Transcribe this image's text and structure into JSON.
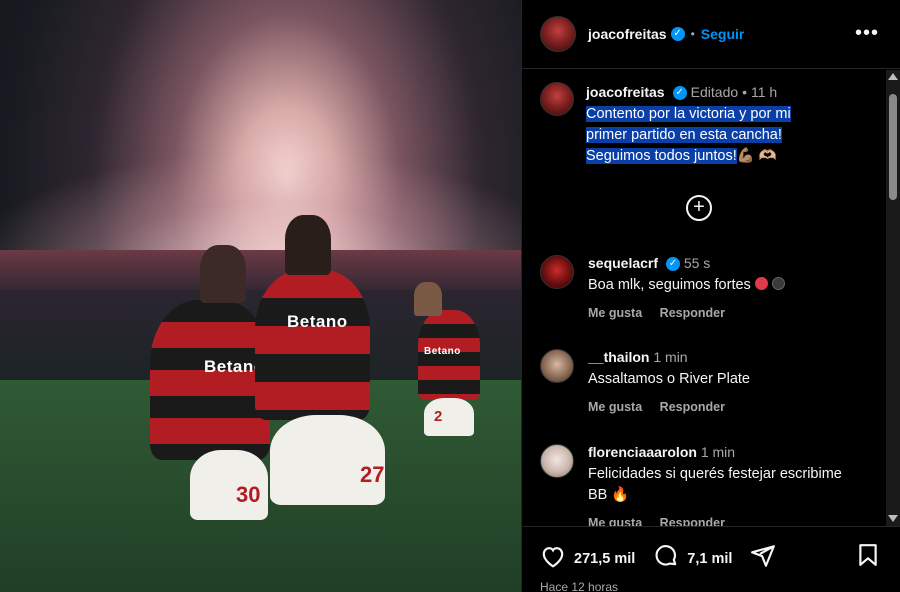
{
  "photo": {
    "sponsor_1": "Betano",
    "sponsor_2": "Betano",
    "sponsor_3": "Betano",
    "number_1": "30",
    "number_2": "27",
    "number_3": "2"
  },
  "header": {
    "username": "joacofreitas",
    "follow_label": "Seguir",
    "more_label": "•••"
  },
  "post": {
    "username": "joacofreitas",
    "edited_label": "Editado",
    "time": "11 h",
    "caption_lines": [
      "Contento por la victoria y por mi",
      "primer partido en esta cancha!",
      "Seguimos todos juntos!"
    ],
    "caption_emoji": "💪🏽 🫶🏼"
  },
  "comments": [
    {
      "username": "sequelacrf",
      "verified": true,
      "time": "55 s",
      "text": "Boa mlk, seguimos fortes",
      "like_label": "Me gusta",
      "reply_label": "Responder"
    },
    {
      "username": "__thailon",
      "verified": false,
      "time": "1 min",
      "text": "Assaltamos o River Plate",
      "like_label": "Me gusta",
      "reply_label": "Responder"
    },
    {
      "username": "florenciaaarolon",
      "verified": false,
      "time": "1 min",
      "text": "Felicidades si querés festejar escribime",
      "text2": "BB 🔥",
      "like_label": "Me gusta",
      "reply_label": "Responder"
    }
  ],
  "footer": {
    "likes": "271,5 mil",
    "comments": "7,1 mil",
    "time_ago": "Hace 12 horas"
  },
  "colors": {
    "accent": "#0095f6",
    "selection": "#0b3fa8",
    "background": "#000000",
    "muted_text": "#a8a8a8"
  }
}
